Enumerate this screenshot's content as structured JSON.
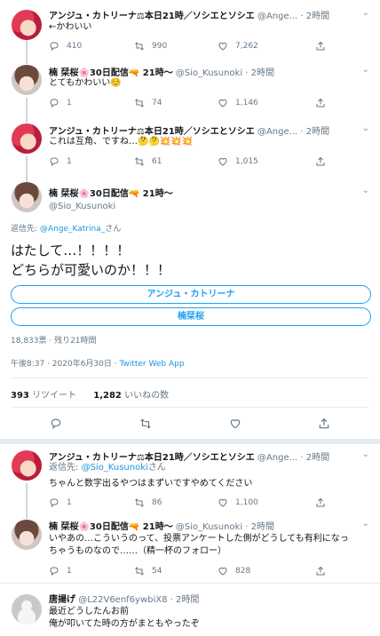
{
  "tweets": [
    {
      "name": "アンジュ・カトリーナ⚖本日21時／ソシエとソシエ",
      "handle": "@Ange...",
      "time": "· 2時間",
      "text": "←かわいい",
      "reply": "",
      "retweet": "990",
      "like": "7,262",
      "reply_count": "410"
    },
    {
      "name": "楠 栞桜🌸30日配信🔫 21時〜",
      "handle": "@Sio_Kusunoki · 2時間",
      "time": "",
      "text": "とてもかわいい☺️",
      "reply_count": "1",
      "retweet": "74",
      "like": "1,146"
    },
    {
      "name": "アンジュ・カトリーナ⚖本日21時／ソシエとソシエ",
      "handle": "@Ange...",
      "time": "· 2時間",
      "text": "これは互角、ですね…🤔🤔💥💥💥",
      "reply_count": "1",
      "retweet": "61",
      "like": "1,015"
    }
  ],
  "main_tweet": {
    "name": "楠 栞桜🌸30日配信🔫 21時〜",
    "handle": "@Sio_Kusunoki",
    "reply_to_prefix": "返信先: ",
    "reply_to_handle": "@Ange_Katrina_",
    "reply_to_suffix": "さん",
    "text_line1": "はたして…！！！！",
    "text_line2": "どちらが可愛いのか！！！",
    "poll_option_1": "アンジュ・カトリーナ",
    "poll_option_2": "楠栞桜",
    "poll_meta": "18,833票 · 残り21時間",
    "timestamp": "午後8:37 · 2020年6月30日 · ",
    "client": "Twitter Web App",
    "retweets_count": "393",
    "retweets_label": "リツイート",
    "likes_count": "1,282",
    "likes_label": "いいねの数"
  },
  "replies": [
    {
      "name": "アンジュ・カトリーナ⚖本日21時／ソシエとソシエ",
      "handle": "@Ange...",
      "time": "· 2時間",
      "reply_to_prefix": "返信先: ",
      "reply_to_handle": "@Sio_Kusunoki",
      "reply_to_suffix": "さん",
      "text": "ちゃんと数字出るやつはまずいですやめてください",
      "reply_count": "1",
      "retweet": "86",
      "like": "1,100"
    },
    {
      "name": "楠 栞桜🌸30日配信🔫 21時〜",
      "handle": "@Sio_Kusunoki · 2時間",
      "time": "",
      "text_line1": "いやあの…こういうのって、投票アンケートした側がどうしても有利になっ",
      "text_line2": "ちゃうものなので……（精一杯のフォロー）",
      "reply_count": "1",
      "retweet": "54",
      "like": "828"
    },
    {
      "name": "唐揚げ",
      "handle": "@L22V6enf6ywbiX8 · 2時間",
      "time": "",
      "text_line1": "最近どうしたんお前",
      "text_line2": "俺が叩いてた時の方がまともやったぞ"
    }
  ],
  "icons": [
    "reply-icon",
    "retweet-icon",
    "like-icon",
    "share-icon",
    "chevron-down-icon"
  ],
  "colors": {
    "accent": "#1da1f2",
    "link": "#1b95e0",
    "muted": "#657786",
    "divider": "#e6ecf0"
  }
}
